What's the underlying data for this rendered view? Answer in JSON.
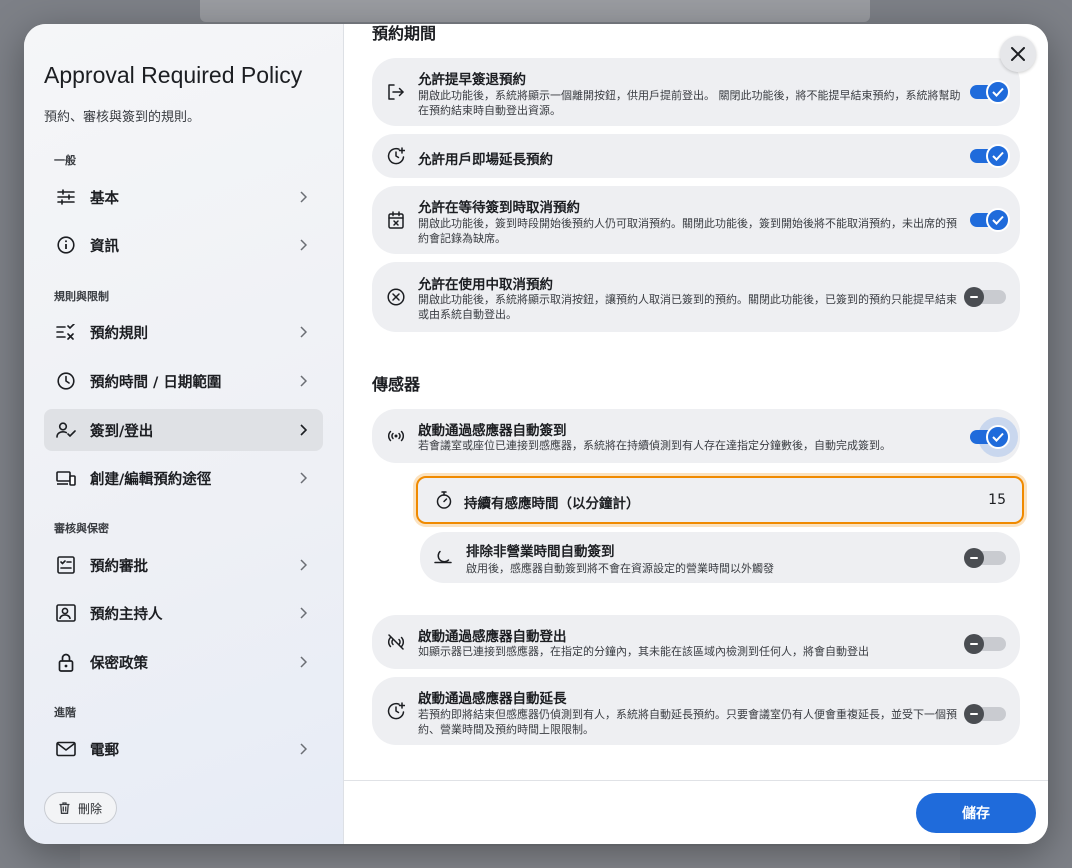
{
  "sidebar": {
    "title": "Approval Required Policy",
    "subtitle": "預約、審核與簽到的規則。",
    "sections": {
      "general": "一般",
      "rules": "規則與限制",
      "review": "審核與保密",
      "advanced": "進階"
    },
    "items": [
      {
        "label": "基本",
        "icon": "sliders-icon"
      },
      {
        "label": "資訊",
        "icon": "info-icon"
      },
      {
        "label": "預約規則",
        "icon": "rules-icon"
      },
      {
        "label": "預約時間 / 日期範圍",
        "icon": "clock-icon"
      },
      {
        "label": "簽到/登出",
        "icon": "user-check-icon",
        "active": true
      },
      {
        "label": "創建/編輯預約途徑",
        "icon": "devices-icon"
      },
      {
        "label": "預約審批",
        "icon": "approval-icon"
      },
      {
        "label": "預約主持人",
        "icon": "host-icon"
      },
      {
        "label": "保密政策",
        "icon": "lock-icon"
      },
      {
        "label": "電郵",
        "icon": "mail-icon"
      }
    ],
    "delete_label": "刪除"
  },
  "content": {
    "period_heading": "預約期間",
    "cards": [
      {
        "title": "允許提早簽退預約",
        "desc": "開啟此功能後，系統將顯示一個離開按鈕，供用戶提前登出。 關閉此功能後，將不能提早結束預約，系統將幫助在預約結束時自動登出資源。",
        "enabled": true
      },
      {
        "title": "允許用戶即場延長預約",
        "desc": "",
        "enabled": true
      },
      {
        "title": "允許在等待簽到時取消預約",
        "desc": "開啟此功能後，簽到時段開始後預約人仍可取消預約。關閉此功能後，簽到開始後將不能取消預約，未出席的預約會記錄為缺席。",
        "enabled": true
      },
      {
        "title": "允許在使用中取消預約",
        "desc": "開啟此功能後，系統將顯示取消按鈕，讓預約人取消已簽到的預約。關閉此功能後，已簽到的預約只能提早結束或由系統自動登出。",
        "enabled": false
      }
    ],
    "sensor_heading": "傳感器",
    "sensor_checkin": {
      "title": "啟動通過感應器自動簽到",
      "desc": "若會議室或座位已連接到感應器，系統將在持續偵測到有人存在達指定分鐘數後，自動完成簽到。",
      "enabled": true
    },
    "duration": {
      "label": "持續有感應時間（以分鐘計）",
      "value": "15"
    },
    "exclude_hours": {
      "title": "排除非營業時間自動簽到",
      "desc": "啟用後，感應器自動簽到將不會在資源設定的營業時間以外觸發",
      "enabled": false
    },
    "sensor_checkout": {
      "title": "啟動通過感應器自動登出",
      "desc": "如顯示器已連接到感應器，在指定的分鐘內，其未能在該區域內檢測到任何人，將會自動登出",
      "enabled": false
    },
    "sensor_extend": {
      "title": "啟動通過感應器自動延長",
      "desc": "若預約即將結束但感應器仍偵測到有人，系統將自動延長預約。只要會議室仍有人便會重複延長，並受下一個預約、營業時間及預約時間上限限制。",
      "enabled": false
    }
  },
  "footer": {
    "save_label": "儲存"
  },
  "colors": {
    "accent": "#1f6bdb",
    "focus": "#f08a00"
  }
}
